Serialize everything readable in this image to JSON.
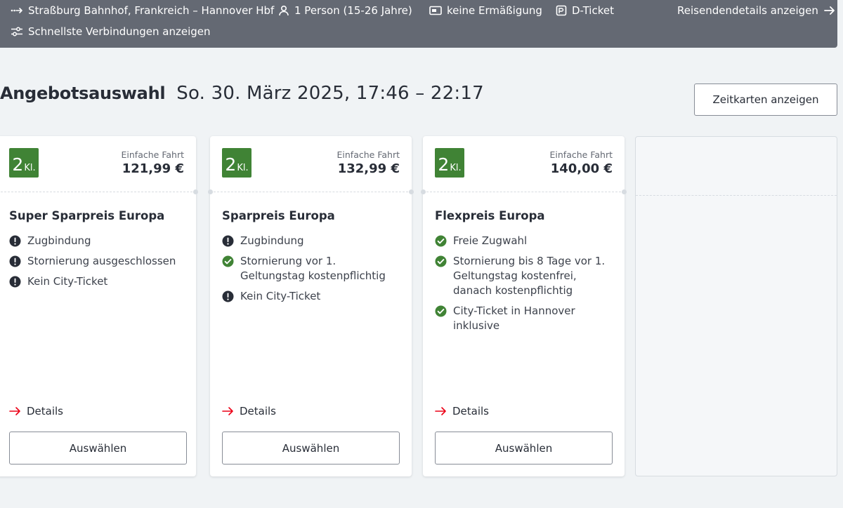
{
  "summary": {
    "route": "Straßburg Bahnhof, Frankreich – Hannover Hbf",
    "travellers": "1 Person (15-26 Jahre)",
    "discount": "keine Ermäßigung",
    "ticket": "D-Ticket",
    "traveller_details_link": "Reisendendetails anzeigen",
    "filter": "Schnellste Verbindungen anzeigen"
  },
  "heading": {
    "title": "Angebotsauswahl",
    "date": "So. 30. März 2025, 17:46 – 22:17"
  },
  "season_ticket_button": "Zeitkarten anzeigen",
  "colors": {
    "accent_green": "#408335",
    "warning": "#282d37",
    "link_arrow": "#ec0016",
    "topbar": "#646973"
  },
  "offers": [
    {
      "class_num": "2",
      "class_label": "Kl.",
      "fare_type": "Einfache Fahrt",
      "price": "121,99 €",
      "name": "Super Sparpreis Europa",
      "features": [
        {
          "icon": "exclamation-icon",
          "text": "Zugbindung"
        },
        {
          "icon": "exclamation-icon",
          "text": "Stornierung ausgeschlossen"
        },
        {
          "icon": "exclamation-icon",
          "text": "Kein City-Ticket"
        }
      ],
      "details": "Details",
      "select": "Auswählen"
    },
    {
      "class_num": "2",
      "class_label": "Kl.",
      "fare_type": "Einfache Fahrt",
      "price": "132,99 €",
      "name": "Sparpreis Europa",
      "features": [
        {
          "icon": "exclamation-icon",
          "text": "Zugbindung"
        },
        {
          "icon": "check-icon",
          "text": "Stornierung vor 1. Geltungstag kostenpflichtig"
        },
        {
          "icon": "exclamation-icon",
          "text": "Kein City-Ticket"
        }
      ],
      "details": "Details",
      "select": "Auswählen"
    },
    {
      "class_num": "2",
      "class_label": "Kl.",
      "fare_type": "Einfache Fahrt",
      "price": "140,00 €",
      "name": "Flexpreis Europa",
      "features": [
        {
          "icon": "check-icon",
          "text": "Freie Zugwahl"
        },
        {
          "icon": "check-icon",
          "text": "Stornierung bis 8 Tage vor 1. Geltungstag kostenfrei, danach kostenpflichtig"
        },
        {
          "icon": "check-icon",
          "text": "City-Ticket in Hannover inklusive"
        }
      ],
      "details": "Details",
      "select": "Auswählen"
    }
  ]
}
